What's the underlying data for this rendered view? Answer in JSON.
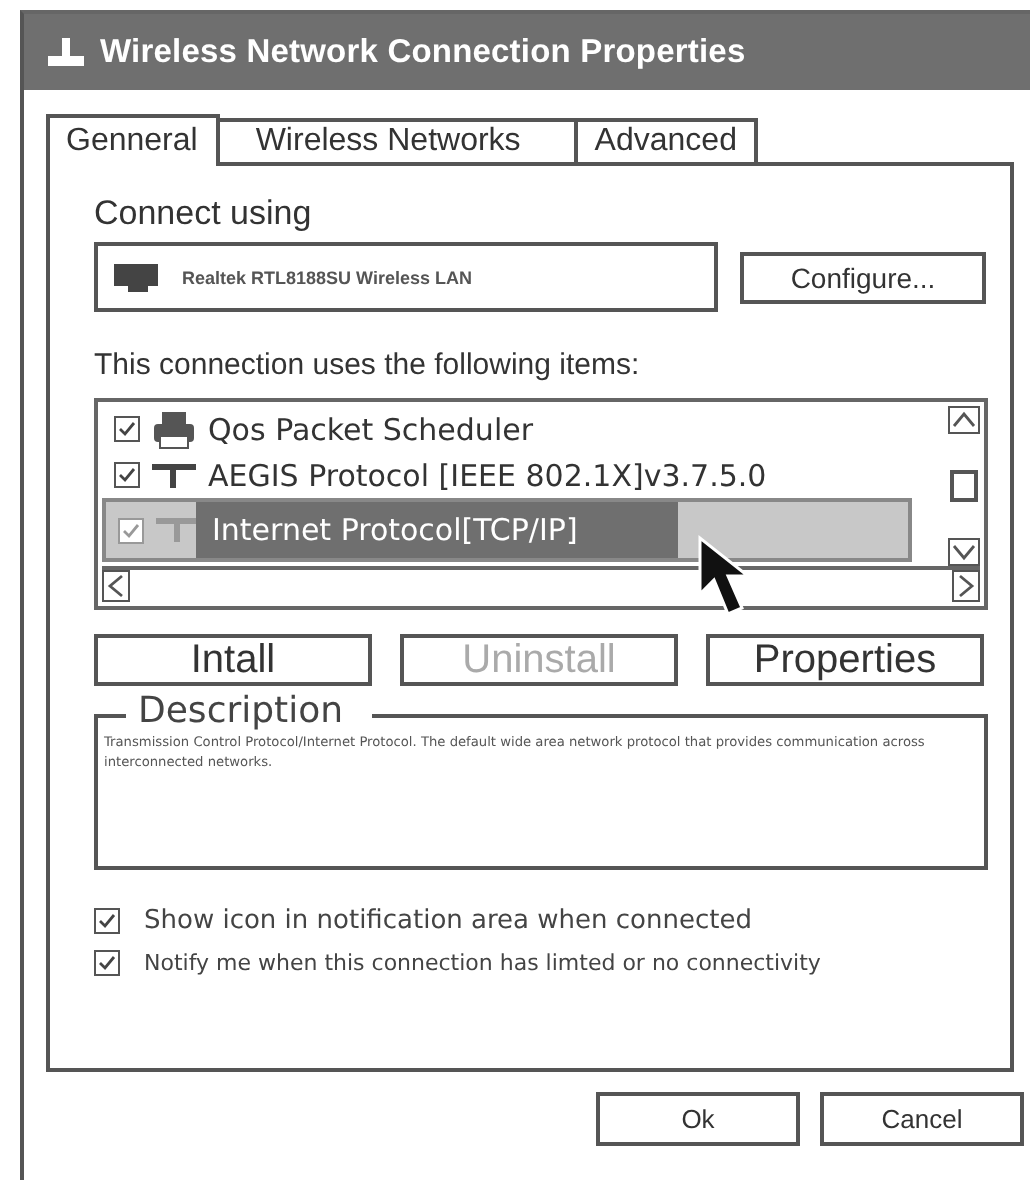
{
  "window": {
    "title": "Wireless Network Connection Properties"
  },
  "tabs": [
    {
      "label": "Genneral",
      "selected": true
    },
    {
      "label": "Wireless Networks",
      "selected": false
    },
    {
      "label": "Advanced",
      "selected": false
    }
  ],
  "connect_using": {
    "label": "Connect using",
    "adapter": "Realtek RTL8188SU Wireless LAN",
    "button": "Configure..."
  },
  "items_label": "This connection uses the following items:",
  "items": [
    {
      "label": "Qos Packet Scheduler",
      "kind": "scheduler",
      "checked": true,
      "selected": false
    },
    {
      "label": "AEGIS Protocol [IEEE 802.1X]v3.7.5.0",
      "kind": "protocol",
      "checked": true,
      "selected": false
    },
    {
      "label": "Internet Protocol[TCP/IP]",
      "kind": "protocol",
      "checked": true,
      "selected": true
    }
  ],
  "item_buttons": [
    {
      "label": "Intall",
      "disabled": false
    },
    {
      "label": "Uninstall",
      "disabled": true
    },
    {
      "label": "Properties",
      "disabled": false
    }
  ],
  "description": {
    "label": "Description",
    "text": "Transmission Control Protocol/Internet Protocol. The default wide area network protocol that provides communication across interconnected networks."
  },
  "options": [
    {
      "label": "Show icon in notification area when connected",
      "checked": true
    },
    {
      "label": "Notify me when this connection has limted or no connectivity",
      "checked": true
    }
  ],
  "buttons": [
    "Ok",
    "Cancel"
  ]
}
